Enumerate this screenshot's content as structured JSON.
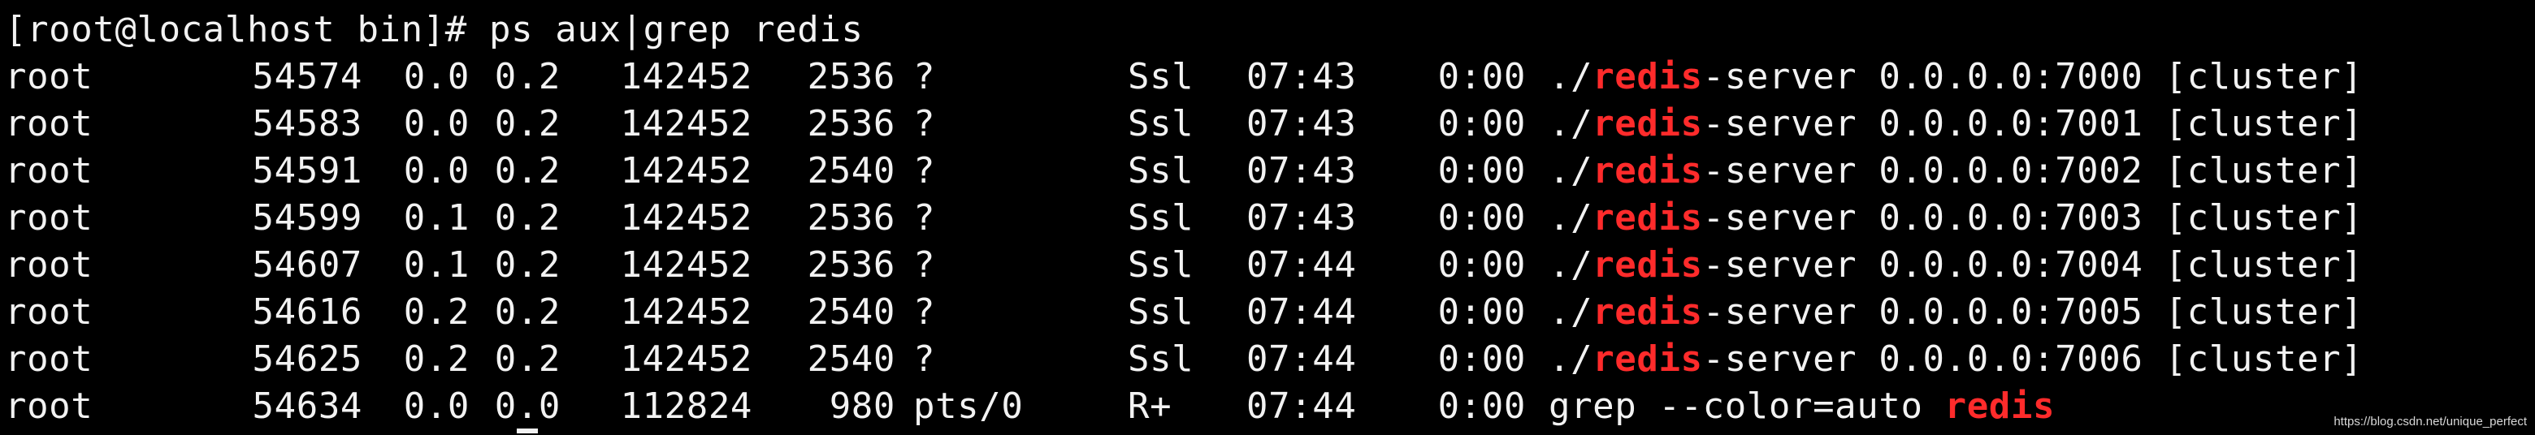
{
  "terminal": {
    "prompt": "[root@localhost bin]# ",
    "command": "ps aux|grep redis",
    "highlight_color": "#ff2b2b",
    "background_color": "#000000",
    "text_color": "#f2f2f2",
    "rows": [
      {
        "user": "root",
        "pid": "54574",
        "cpu": "0.0",
        "mem": "0.2",
        "vsz": "142452",
        "rss": "2536",
        "tty": "?",
        "stat": "Ssl",
        "start": "07:43",
        "time": "0:00",
        "cmd_pre": "./",
        "cmd_hl": "redis",
        "cmd_post": "-server 0.0.0.0:7000 [cluster]"
      },
      {
        "user": "root",
        "pid": "54583",
        "cpu": "0.0",
        "mem": "0.2",
        "vsz": "142452",
        "rss": "2536",
        "tty": "?",
        "stat": "Ssl",
        "start": "07:43",
        "time": "0:00",
        "cmd_pre": "./",
        "cmd_hl": "redis",
        "cmd_post": "-server 0.0.0.0:7001 [cluster]"
      },
      {
        "user": "root",
        "pid": "54591",
        "cpu": "0.0",
        "mem": "0.2",
        "vsz": "142452",
        "rss": "2540",
        "tty": "?",
        "stat": "Ssl",
        "start": "07:43",
        "time": "0:00",
        "cmd_pre": "./",
        "cmd_hl": "redis",
        "cmd_post": "-server 0.0.0.0:7002 [cluster]"
      },
      {
        "user": "root",
        "pid": "54599",
        "cpu": "0.1",
        "mem": "0.2",
        "vsz": "142452",
        "rss": "2536",
        "tty": "?",
        "stat": "Ssl",
        "start": "07:43",
        "time": "0:00",
        "cmd_pre": "./",
        "cmd_hl": "redis",
        "cmd_post": "-server 0.0.0.0:7003 [cluster]"
      },
      {
        "user": "root",
        "pid": "54607",
        "cpu": "0.1",
        "mem": "0.2",
        "vsz": "142452",
        "rss": "2536",
        "tty": "?",
        "stat": "Ssl",
        "start": "07:44",
        "time": "0:00",
        "cmd_pre": "./",
        "cmd_hl": "redis",
        "cmd_post": "-server 0.0.0.0:7004 [cluster]"
      },
      {
        "user": "root",
        "pid": "54616",
        "cpu": "0.2",
        "mem": "0.2",
        "vsz": "142452",
        "rss": "2540",
        "tty": "?",
        "stat": "Ssl",
        "start": "07:44",
        "time": "0:00",
        "cmd_pre": "./",
        "cmd_hl": "redis",
        "cmd_post": "-server 0.0.0.0:7005 [cluster]"
      },
      {
        "user": "root",
        "pid": "54625",
        "cpu": "0.2",
        "mem": "0.2",
        "vsz": "142452",
        "rss": "2540",
        "tty": "?",
        "stat": "Ssl",
        "start": "07:44",
        "time": "0:00",
        "cmd_pre": "./",
        "cmd_hl": "redis",
        "cmd_post": "-server 0.0.0.0:7006 [cluster]"
      },
      {
        "user": "root",
        "pid": "54634",
        "cpu": "0.0",
        "mem": "0.0",
        "vsz": "112824",
        "rss": "980",
        "tty": "pts/0",
        "stat": "R+",
        "start": "07:44",
        "time": "0:00",
        "cmd_pre": "grep --color=auto ",
        "cmd_hl": "redis",
        "cmd_post": ""
      }
    ]
  },
  "watermark": "https://blog.csdn.net/unique_perfect"
}
